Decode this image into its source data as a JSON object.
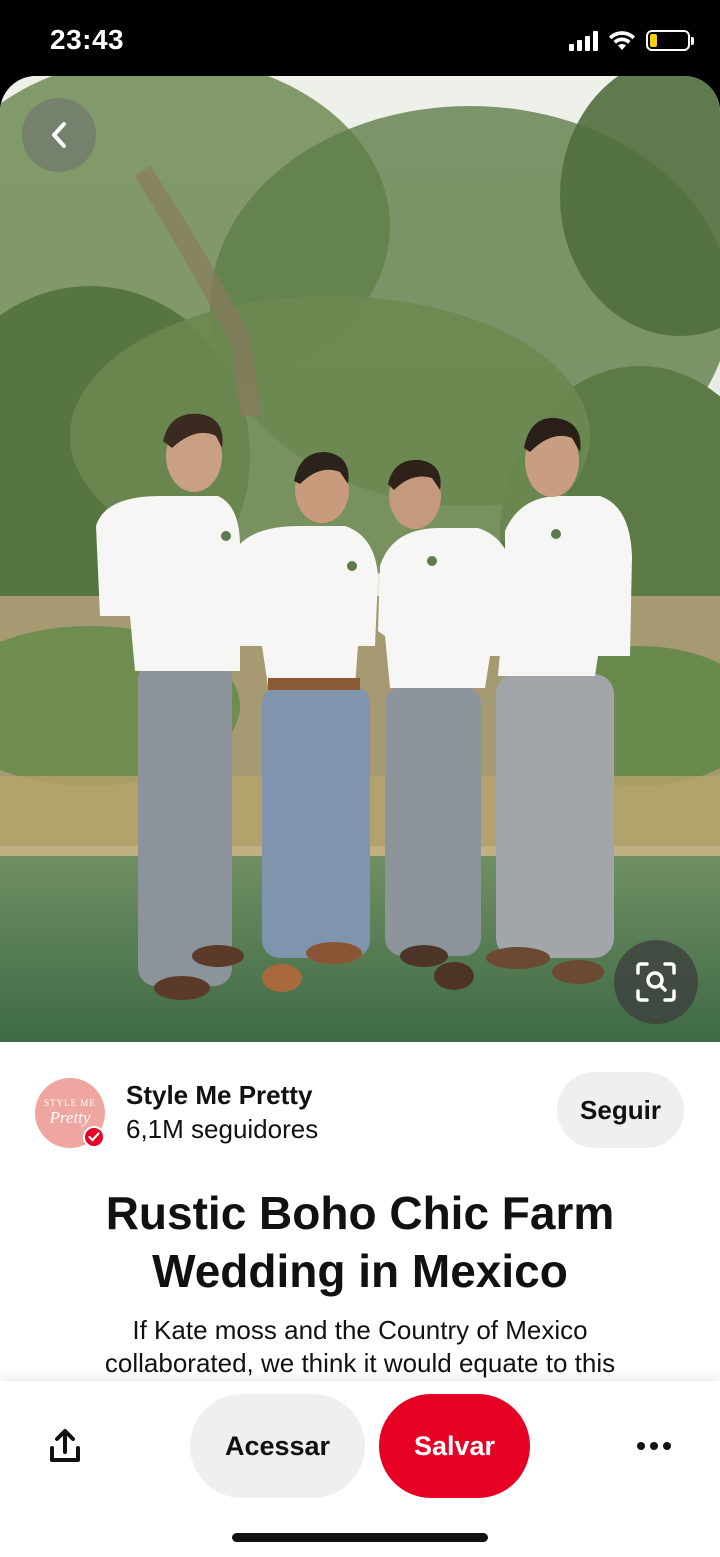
{
  "status_bar": {
    "time": "23:43",
    "icons": [
      "signal-icon",
      "wifi-icon",
      "battery-icon"
    ],
    "battery_level": 0.2,
    "battery_color": "#f7d000"
  },
  "pin": {
    "image_alt": "Four groomsmen in white shirts and grey trousers standing on a lawn",
    "back_icon": "chevron-left-icon",
    "visual_search_icon": "visual-search-icon"
  },
  "author": {
    "name": "Style Me Pretty",
    "followers": "6,1M seguidores",
    "avatar_text_top": "STYLE ME",
    "avatar_text_script": "Pretty",
    "follow_label": "Seguir",
    "avatar_color": "#f0a6a0"
  },
  "title_lines": [
    "Rustic Boho Chic Farm",
    "Wedding in Mexico"
  ],
  "description_lines": [
    "If Kate moss and the Country of Mexico",
    "collaborated, we think it would equate to this"
  ],
  "actions": {
    "share_icon": "share-icon",
    "visit_label": "Acessar",
    "save_label": "Salvar",
    "more_icon": "more-options-icon",
    "save_color": "#e60023"
  }
}
